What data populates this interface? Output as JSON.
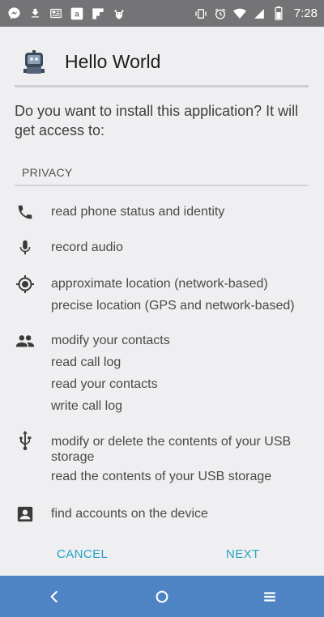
{
  "status_bar": {
    "time": "7:28",
    "left_icons": [
      "messenger-icon",
      "download-icon",
      "news-icon",
      "amazon-icon",
      "flipboard-icon",
      "android-debug-icon"
    ],
    "right_icons": [
      "vibrate-icon",
      "alarm-icon",
      "wifi-icon",
      "signal-icon",
      "battery-icon"
    ]
  },
  "app": {
    "name": "Hello World",
    "icon": "app-robot-icon"
  },
  "prompt": {
    "question": "Do you want to install this application? It will get access to:"
  },
  "section": {
    "label": "PRIVACY"
  },
  "permissions": [
    {
      "icon": "phone-icon",
      "lines": [
        "read phone status and identity"
      ]
    },
    {
      "icon": "microphone-icon",
      "lines": [
        "record audio"
      ]
    },
    {
      "icon": "location-icon",
      "lines": [
        "approximate location (network-based)",
        "precise location (GPS and network-based)"
      ]
    },
    {
      "icon": "contacts-icon",
      "lines": [
        "modify your contacts",
        "read call log",
        "read your contacts",
        "write call log"
      ]
    },
    {
      "icon": "usb-icon",
      "lines": [
        "modify or delete the contents of your USB storage",
        "read the contents of your USB storage"
      ]
    },
    {
      "icon": "account-icon",
      "lines": [
        "find accounts on the device"
      ]
    }
  ],
  "actions": {
    "cancel": "CANCEL",
    "next": "NEXT"
  },
  "nav_bar": {
    "icons": [
      "back-icon",
      "home-icon",
      "menu-icon"
    ],
    "color": "#4f84c4"
  },
  "colors": {
    "accent": "#27a4c7",
    "status_bar": "#747476",
    "background": "#efeef0"
  }
}
